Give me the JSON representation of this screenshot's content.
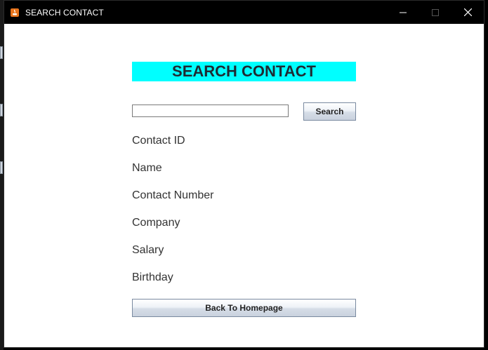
{
  "window": {
    "title": "SEARCH CONTACT",
    "icon": "java-app-icon",
    "controls": {
      "minimize": "—",
      "maximize": "☐",
      "close": "✕"
    }
  },
  "form": {
    "heading": "SEARCH CONTACT",
    "heading_bg": "#00ffff",
    "search_input_value": "",
    "search_button": "Search",
    "fields": [
      "Contact ID",
      "Name",
      "Contact Number",
      "Company",
      "Salary",
      "Birthday"
    ],
    "back_button": "Back To Homepage"
  }
}
